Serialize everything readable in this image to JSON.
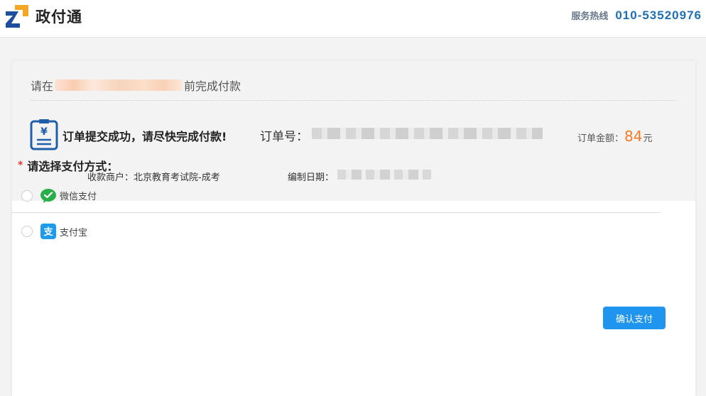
{
  "header": {
    "brand": "政付通",
    "hotline_label": "服务热线",
    "hotline_number": "010-53520976"
  },
  "order": {
    "deadline_prefix": "请在",
    "deadline_suffix": "前完成付款",
    "success_message": "订单提交成功，请尽快完成付款!",
    "order_no_label": "订单号：",
    "amount_label": "订单金额：",
    "amount_value": "84",
    "amount_unit": "元",
    "merchant": "收款商户：北京教育考试院-成考",
    "date_label": "编制日期："
  },
  "payment": {
    "required_mark": "*",
    "title": "请选择支付方式：",
    "options": [
      {
        "label": "微信支付",
        "icon": "wechat-pay-icon",
        "selected": false
      },
      {
        "label": "支付宝",
        "icon": "alipay-icon",
        "selected": false
      }
    ],
    "confirm_label": "确认支付"
  },
  "colors": {
    "accent": "#1f95f0",
    "amount": "#f57a26",
    "hotline": "#1f6fb5",
    "logo_blue": "#1d4f9c",
    "logo_orange": "#f5a623",
    "wechat_green": "#2aae4a",
    "alipay_blue": "#1e9bea"
  }
}
